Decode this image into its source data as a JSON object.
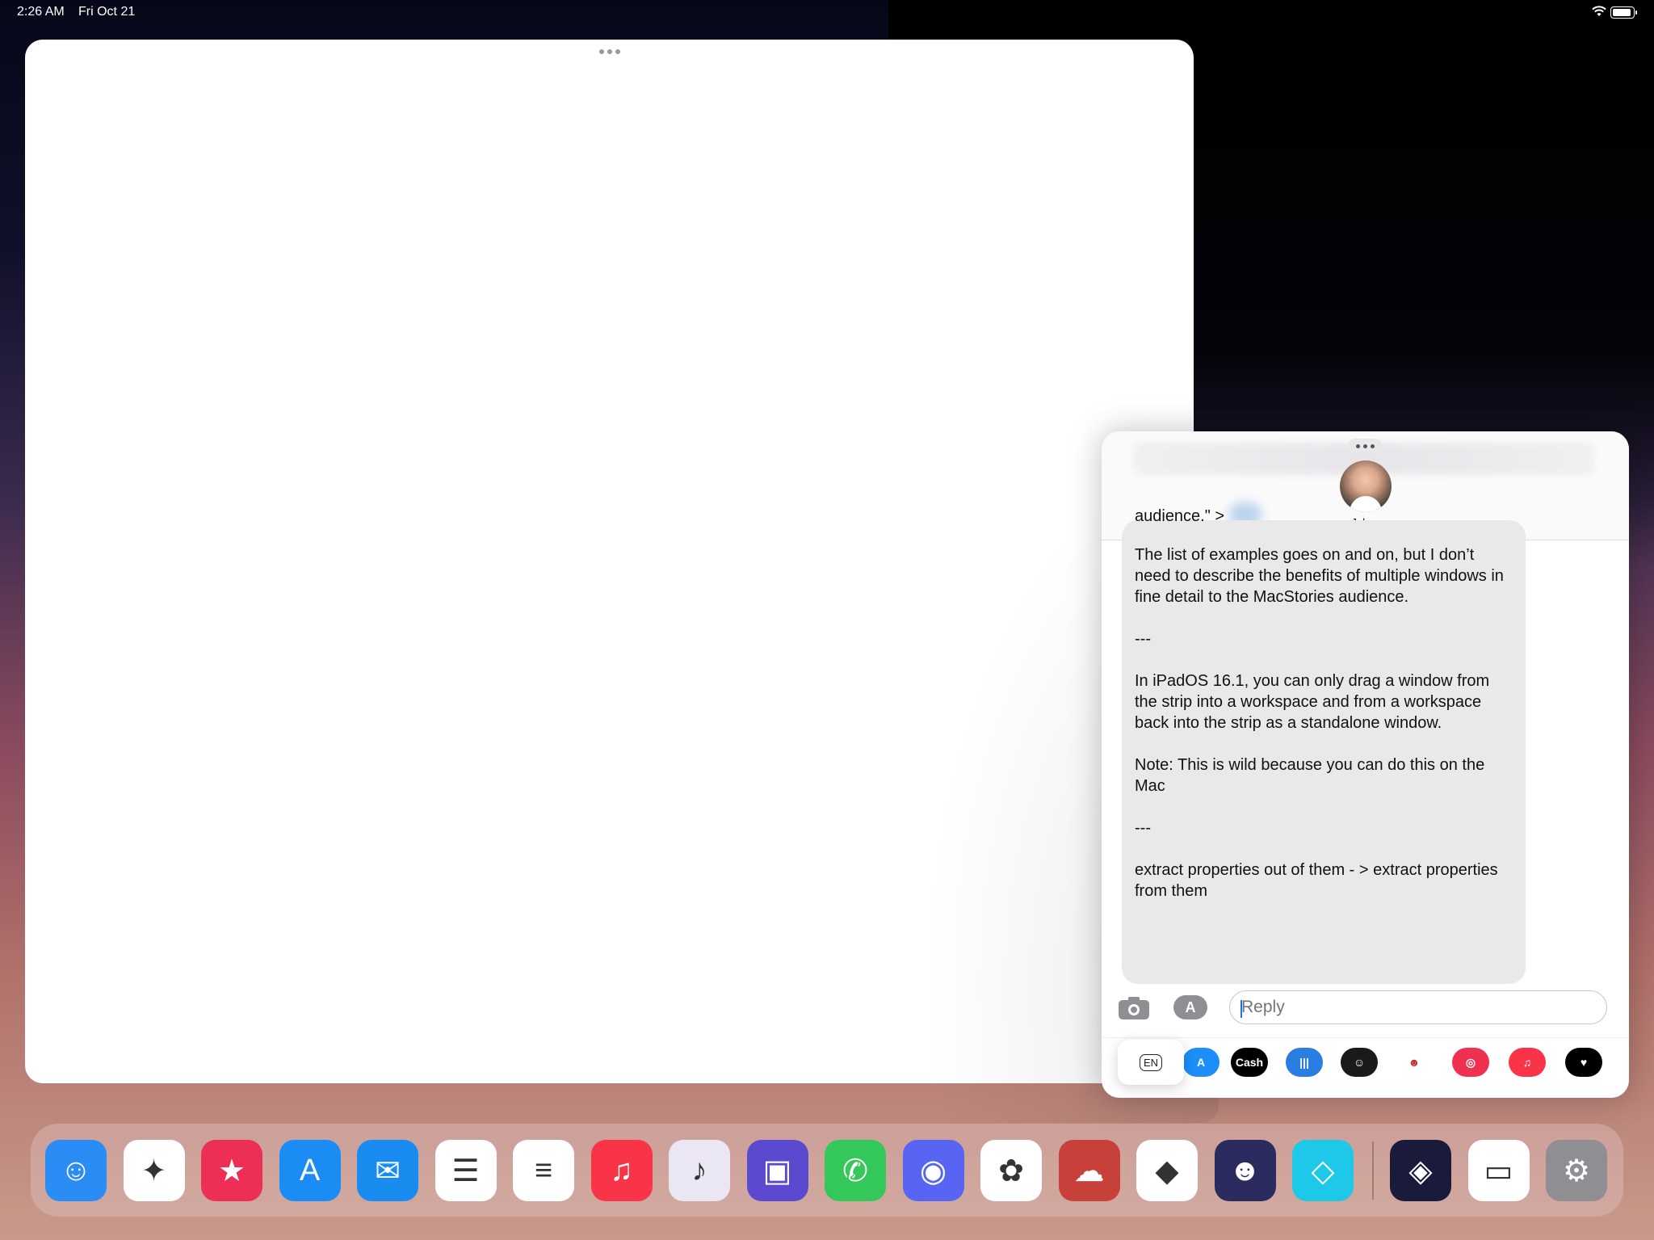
{
  "status_bar": {
    "time": "2:26 AM",
    "date": "Fri Oct 21"
  },
  "messages_window": {
    "contact_name": "John",
    "message_paragraphs": [
      "audience.\" >",
      "The list of examples goes on and on, but I don’t need to describe the benefits of multiple windows in fine detail to the MacStories audience.",
      "---",
      " In iPadOS 16.1, you can only drag a window from the strip into a workspace and from a workspace back into the strip as a standalone window.",
      "Note: This is wild because you can do this on the Mac",
      "---",
      "extract properties out of them - > extract properties from them"
    ],
    "reply_placeholder": "Reply",
    "keyboard_language": "EN",
    "app_strip": [
      {
        "name": "app-store-icon",
        "color": "#1c8ef9",
        "label": "A"
      },
      {
        "name": "apple-cash-icon",
        "color": "#000000",
        "label": "Cash"
      },
      {
        "name": "audio-message-icon",
        "color": "#2a7de1",
        "label": "|||"
      },
      {
        "name": "memoji-icon",
        "color": "#1a1a1a",
        "label": "☺"
      },
      {
        "name": "animoji-icon",
        "color": "#ffffff",
        "label": "☻"
      },
      {
        "name": "images-search-icon",
        "color": "#f03050",
        "label": "◎"
      },
      {
        "name": "music-icon",
        "color": "#fa3448",
        "label": "♫"
      },
      {
        "name": "digital-touch-icon",
        "color": "#000000",
        "label": "♥"
      }
    ]
  },
  "dock": [
    {
      "name": "finder-icon",
      "color": "#2a8cf5",
      "glyph": "☺"
    },
    {
      "name": "safari-icon",
      "color": "#ffffff",
      "glyph": "✦"
    },
    {
      "name": "goodlinks-icon",
      "color": "#ee2f55",
      "glyph": "★"
    },
    {
      "name": "app-store-icon",
      "color": "#1b8cf3",
      "glyph": "A"
    },
    {
      "name": "mail-icon",
      "color": "#1a8cf0",
      "glyph": "✉"
    },
    {
      "name": "reminders-icon",
      "color": "#ffffff",
      "glyph": "☰"
    },
    {
      "name": "notes-icon",
      "color": "#ffffff",
      "glyph": "≡"
    },
    {
      "name": "music-icon",
      "color": "#fa3448",
      "glyph": "♫"
    },
    {
      "name": "marvis-icon",
      "color": "#eae6f4",
      "glyph": "♪"
    },
    {
      "name": "mastodon-icon",
      "color": "#5b4ad0",
      "glyph": "▣"
    },
    {
      "name": "messages-icon",
      "color": "#34c759",
      "glyph": "✆"
    },
    {
      "name": "discord-icon",
      "color": "#5865f2",
      "glyph": "◉"
    },
    {
      "name": "photos-icon",
      "color": "#ffffff",
      "glyph": "✿"
    },
    {
      "name": "cloud-app-icon",
      "color": "#c8403a",
      "glyph": "☁"
    },
    {
      "name": "obsidian-icon",
      "color": "#ffffff",
      "glyph": "◆"
    },
    {
      "name": "robot-app-icon",
      "color": "#2b2b60",
      "glyph": "☻"
    },
    {
      "name": "tailscale-icon",
      "color": "#1ec8e8",
      "glyph": "◇"
    },
    {
      "name": "shortcuts-icon",
      "color": "#1a1a3a",
      "glyph": "◈"
    },
    {
      "name": "files-icon",
      "color": "#ffffff",
      "glyph": "▭"
    },
    {
      "name": "settings-icon",
      "color": "#8e8e93",
      "glyph": "⚙"
    }
  ]
}
